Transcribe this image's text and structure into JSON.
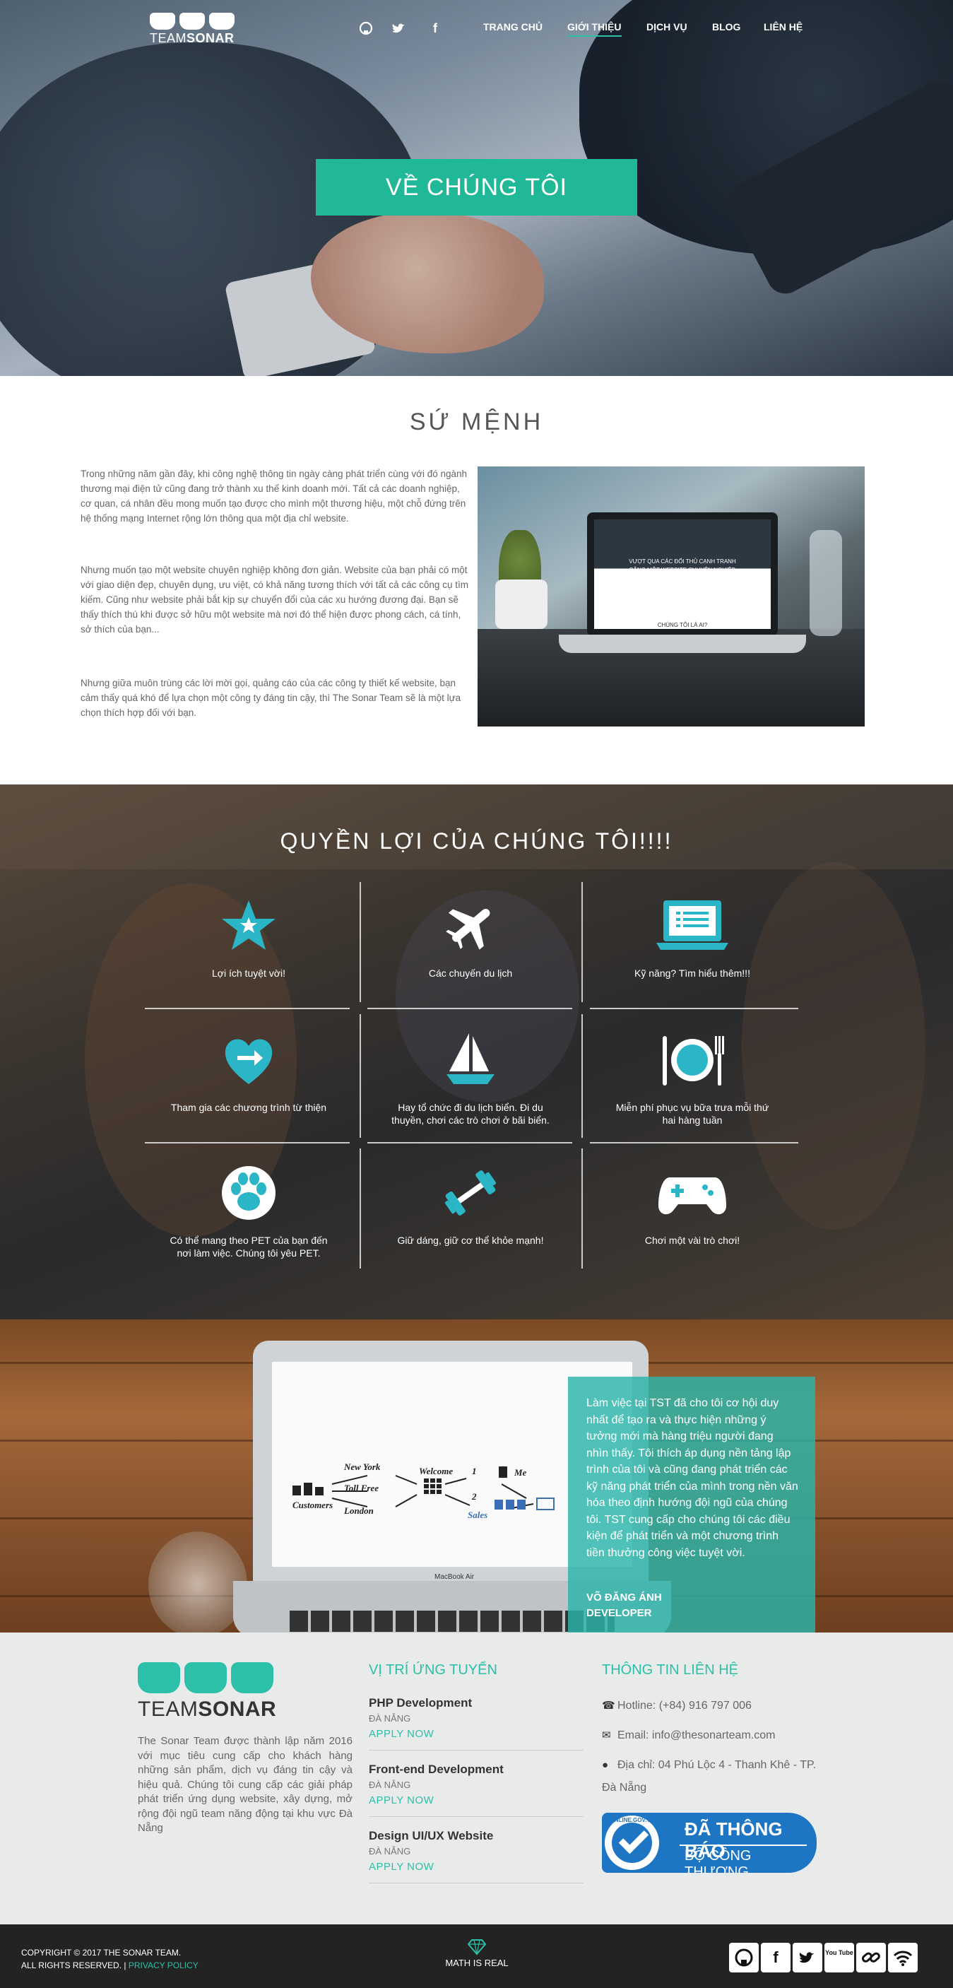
{
  "brand": {
    "logo_light": "TEAM",
    "logo_bold": "SONAR"
  },
  "nav": {
    "social": [
      "github-icon",
      "twitter-icon",
      "facebook-icon"
    ],
    "links": [
      {
        "label": "TRANG CHỦ",
        "active": false
      },
      {
        "label": "GIỚI THIỆU",
        "active": true
      },
      {
        "label": "DỊCH VỤ",
        "active": false
      },
      {
        "label": "BLOG",
        "active": false
      },
      {
        "label": "LIÊN HỆ",
        "active": false
      }
    ]
  },
  "hero": {
    "button": "VỀ CHÚNG TÔI"
  },
  "mission": {
    "title": "SỨ MỆNH",
    "paragraphs": [
      "Trong những năm gần đây, khi công nghệ thông tin ngày càng phát triển cùng với đó ngành thương mại điện tử cũng đang trở thành xu thế kinh doanh mới. Tất cả các doanh nghiệp, cơ quan, cá nhân đều mong muốn tạo được cho mình một thương hiệu, một chỗ đứng trên hệ thống mạng Internet rộng lớn thông qua một địa chỉ website.",
      "Nhưng muốn tạo một website chuyên nghiệp không đơn giản. Website của bạn phải có một với giao diện đẹp, chuyên dụng, ưu việt, có khả năng tương thích với tất cả các công cụ tìm kiếm. Cũng như website phải bắt kịp sự chuyển đổi của các xu hướng đương đại. Bạn sẽ thấy thích thú khi được sở hữu một website mà nơi đó thể hiện được phong cách, cá tính, sở thích của bạn...",
      "Nhưng giữa muôn trùng các lời mời gọi, quảng cáo của các công ty thiết kế website, bạn cảm thấy quá khó để lựa chọn một công ty đáng tin cậy, thì The Sonar Team sẽ là một lựa chọn thích hợp đối với bạn."
    ],
    "screen_title": "VƯỢT QUA CÁC ĐỐI THỦ CẠNH TRANH",
    "screen_sub": "BẰNG MỘT WEBSITE CHUYÊN NGHIỆP",
    "screen_link": "CHÚNG TÔI LÀ AI?"
  },
  "benefits": {
    "title": "QUYỀN LỢI CỦA CHÚNG TÔI!!!!",
    "items": [
      {
        "icon": "star-icon",
        "label": "Lợi ích tuyệt vời!"
      },
      {
        "icon": "airplane-icon",
        "label": "Các chuyến du lịch"
      },
      {
        "icon": "laptop-icon",
        "label": "Kỹ năng? Tìm hiểu thêm!!!"
      },
      {
        "icon": "heart-arrow-icon",
        "label": "Tham gia các chương trình từ thiện"
      },
      {
        "icon": "sailboat-icon",
        "label": "Hay tổ chức đi du lịch biển. Đi du thuyền, chơi các trò chơi ở bãi biển."
      },
      {
        "icon": "plate-cutlery-icon",
        "label": "Miễn phí phục vụ bữa trưa mỗi thứ hai hàng tuần"
      },
      {
        "icon": "paw-icon",
        "label": "Có thể mang theo PET của bạn đến nơi làm việc. Chúng tôi yêu PET."
      },
      {
        "icon": "dumbbell-icon",
        "label": "Giữ dáng, giữ cơ thể khỏe mạnh!"
      },
      {
        "icon": "gamepad-icon",
        "label": "Chơi một vài trò chơi!"
      }
    ]
  },
  "testimonial": {
    "quote": "Làm việc tại TST đã cho tôi cơ hội duy nhất để tạo ra và thực hiện những ý tưởng mới mà hàng triệu người đang nhìn thấy. Tôi thích áp dụng nền tảng lập trình của tôi và cũng đang phát triển các kỹ năng phát triển của mình trong nền văn hóa theo định hướng đội ngũ của chúng tôi. TST cung cấp cho chúng tôi các điều kiện để phát triển và một chương trình tiền thưởng công việc tuyệt vời.",
    "name": "VÕ ĐĂNG ÁNH",
    "role": "DEVELOPER",
    "diagram": {
      "customers": "Customers",
      "a": "New York",
      "b": "Toll Free",
      "c": "London",
      "welcome": "Welcome",
      "me": "Me",
      "sales": "Sales",
      "n1": "1",
      "n2": "2",
      "brand": "MacBook Air"
    }
  },
  "footer": {
    "about": "The Sonar Team được thành lập năm 2016 với mục tiêu cung cấp cho khách hàng những sản phẩm, dịch vụ đáng tin cậy và hiệu quả. Chúng tôi cung cấp các giải pháp phát triển ứng dụng website, xây dựng, mở rộng đội ngũ team năng động tại khu vực Đà Nẵng",
    "jobs_title": "VỊ TRÍ ỨNG TUYỂN",
    "jobs": [
      {
        "title": "PHP Development",
        "city": "ĐÀ NẴNG",
        "apply": "APPLY NOW"
      },
      {
        "title": "Front-end Development",
        "city": "ĐÀ NẴNG",
        "apply": "APPLY NOW"
      },
      {
        "title": "Design UI/UX Website",
        "city": "ĐÀ NẴNG",
        "apply": "APPLY NOW"
      }
    ],
    "contact_title": "THÔNG TIN LIÊN HỆ",
    "hotline": "Hotline: (+84) 916 797 006",
    "email": "Email: info@thesonarteam.com",
    "address": "Địa chỉ: 04 Phú Lộc 4 - Thanh Khê - TP. Đà Nẵng",
    "badge_small": "ONLINE.GOV.VN",
    "badge_line1": "ĐÃ THÔNG BÁO",
    "badge_line2": "BỘ CÔNG THƯƠNG"
  },
  "bottom": {
    "copyright": "COPYRIGHT © 2017 THE SONAR TEAM.",
    "rights": "ALL RIGHTS RESERVED. |",
    "privacy": "PRIVACY POLICY",
    "motto": "MATH IS REAL",
    "social": [
      "github-icon",
      "facebook-icon",
      "twitter-icon",
      "youtube-icon",
      "link-icon",
      "wifi-icon"
    ],
    "youtube_text": "You Tube"
  },
  "colors": {
    "accent": "#2bc0a7",
    "hero_button": "#20b897",
    "dark_bar": "#232323",
    "footer_bg": "#e9eaea"
  }
}
